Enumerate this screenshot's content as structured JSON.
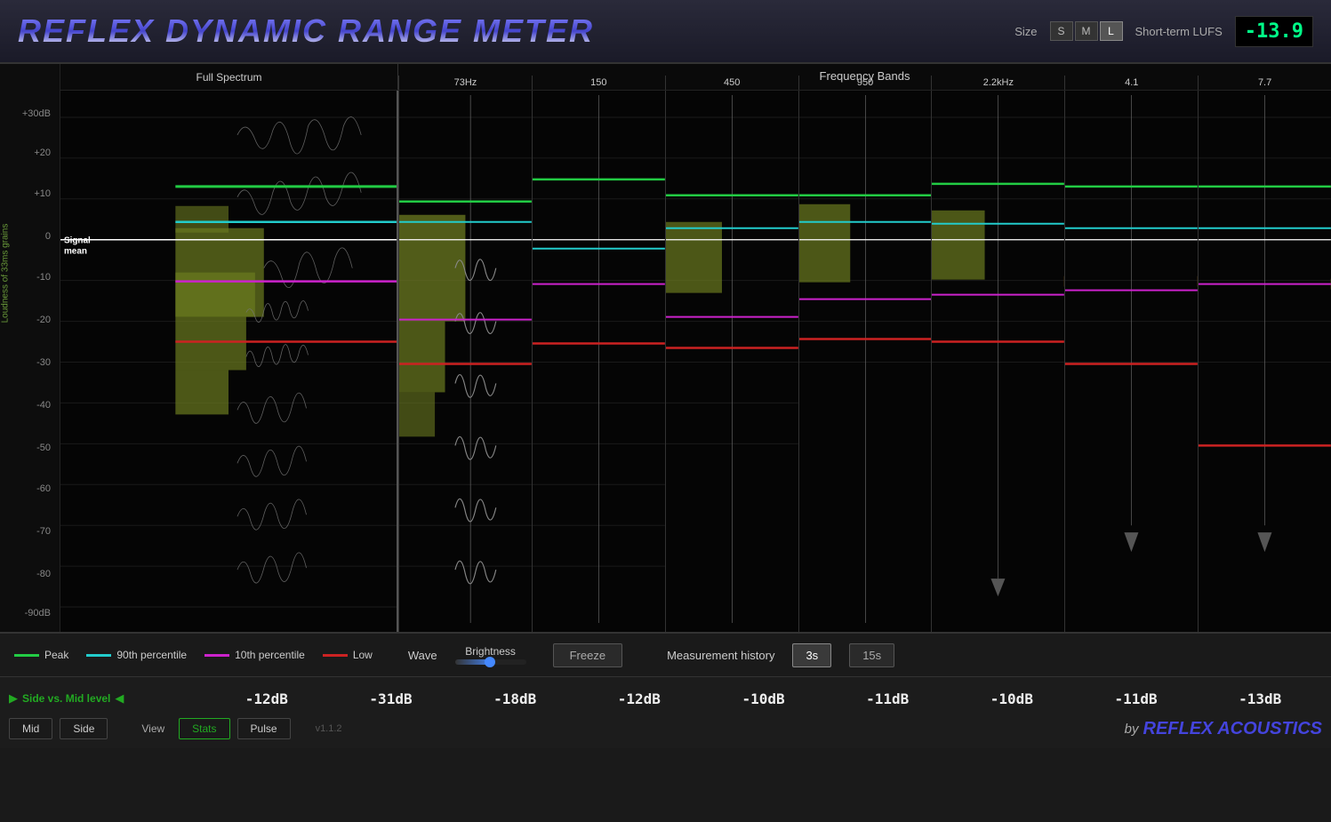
{
  "header": {
    "title": "REFLEX DYNAMIC RANGE METER",
    "size_label": "Size",
    "sizes": [
      "S",
      "M",
      "L"
    ],
    "active_size": "L",
    "lufs_label": "Short-term LUFS",
    "lufs_value": "-13.9"
  },
  "panels": {
    "full_spectrum_label": "Full Spectrum",
    "freq_bands_label": "Frequency Bands",
    "freq_bands": [
      "73Hz",
      "150",
      "450",
      "950",
      "2.2kHz",
      "4.1",
      "7.7"
    ]
  },
  "y_axis": {
    "labels": [
      "+30dB",
      "+20",
      "+10",
      "0",
      "-10",
      "-20",
      "-30",
      "-40",
      "-50",
      "-60",
      "-70",
      "-80",
      "-90dB"
    ],
    "vertical_label": "Loudness of 33ms grains"
  },
  "legend": {
    "peak_label": "Peak",
    "percentile_90_label": "90th percentile",
    "percentile_10_label": "10th percentile",
    "low_label": "Low",
    "wave_label": "Wave",
    "brightness_label": "Brightness",
    "freeze_label": "Freeze",
    "measurement_label": "Measurement history",
    "time_3s": "3s",
    "time_15s": "15s"
  },
  "stats": {
    "mid_side_label": "Side vs. Mid level",
    "values": [
      "-12dB",
      "-31dB",
      "-18dB",
      "-12dB",
      "-10dB",
      "-11dB",
      "-10dB",
      "-11dB",
      "-13dB"
    ],
    "signal_mean_label": "Signal\nmean",
    "version": "v1.1.2"
  },
  "bottom_buttons": {
    "mid_label": "Mid",
    "side_label": "Side",
    "view_label": "View",
    "stats_label": "Stats",
    "pulse_label": "Pulse"
  },
  "branding": {
    "prefix": "by",
    "name": "REFLEX ACOUSTICS"
  },
  "colors": {
    "peak": "#22cc44",
    "percentile_90": "#22cccc",
    "percentile_10": "#cc22cc",
    "low": "#cc2222",
    "signal_mean": "#ffffff",
    "accent_blue": "#4488ff",
    "accent_green": "#22aa22"
  }
}
